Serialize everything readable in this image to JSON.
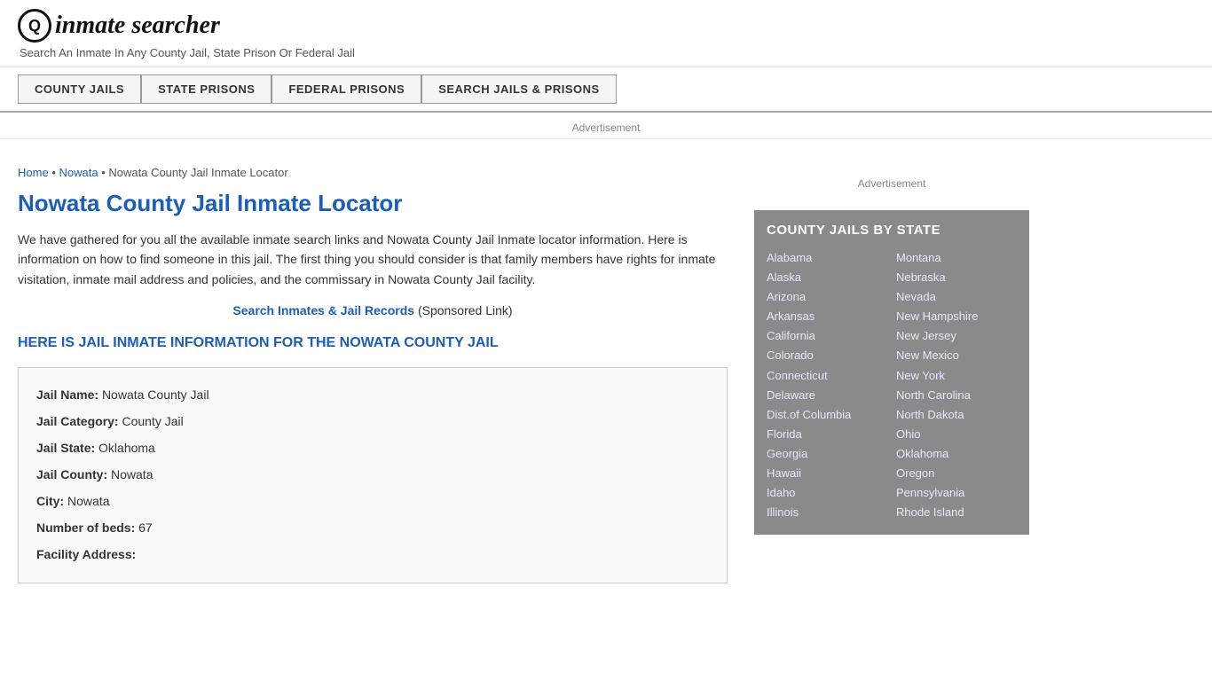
{
  "header": {
    "logo_letter": "Q",
    "logo_brand": "inmate searcher",
    "tagline": "Search An Inmate In Any County Jail, State Prison Or Federal Jail"
  },
  "nav": {
    "buttons": [
      {
        "label": "COUNTY JAILS",
        "id": "county-jails"
      },
      {
        "label": "STATE PRISONS",
        "id": "state-prisons"
      },
      {
        "label": "FEDERAL PRISONS",
        "id": "federal-prisons"
      },
      {
        "label": "SEARCH JAILS & PRISONS",
        "id": "search-jails"
      }
    ]
  },
  "ad_label": "Advertisement",
  "breadcrumb": {
    "home": "Home",
    "nowata": "Nowata",
    "current": "Nowata County Jail Inmate Locator"
  },
  "page_title": "Nowata County Jail Inmate Locator",
  "intro_text": "We have gathered for you all the available inmate search links and Nowata County Jail Inmate locator information. Here is information on how to find someone in this jail. The first thing you should consider is that family members have rights for inmate visitation, inmate mail address and policies, and the commissary in Nowata County Jail facility.",
  "search_link": {
    "label": "Search Inmates & Jail Records",
    "sponsored": "(Sponsored Link)"
  },
  "section_heading": "HERE IS JAIL INMATE INFORMATION FOR THE NOWATA COUNTY JAIL",
  "jail_info": {
    "name_label": "Jail Name:",
    "name_value": "Nowata County Jail",
    "category_label": "Jail Category:",
    "category_value": "County Jail",
    "state_label": "Jail State:",
    "state_value": "Oklahoma",
    "county_label": "Jail County:",
    "county_value": "Nowata",
    "city_label": "City:",
    "city_value": "Nowata",
    "beds_label": "Number of beds:",
    "beds_value": "67",
    "address_label": "Facility Address:"
  },
  "sidebar": {
    "ad_label": "Advertisement",
    "box_title": "COUNTY JAILS BY STATE",
    "states_col1": [
      "Alabama",
      "Alaska",
      "Arizona",
      "Arkansas",
      "California",
      "Colorado",
      "Connecticut",
      "Delaware",
      "Dist.of Columbia",
      "Florida",
      "Georgia",
      "Hawaii",
      "Idaho",
      "Illinois"
    ],
    "states_col2": [
      "Montana",
      "Nebraska",
      "Nevada",
      "New Hampshire",
      "New Jersey",
      "New Mexico",
      "New York",
      "North Carolina",
      "North Dakota",
      "Ohio",
      "Oklahoma",
      "Oregon",
      "Pennsylvania",
      "Rhode Island"
    ]
  }
}
